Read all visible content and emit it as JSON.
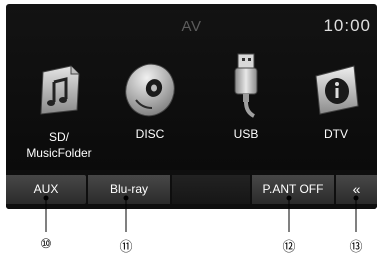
{
  "header": {
    "title": "AV",
    "clock": "10:00"
  },
  "sources": [
    {
      "label": "SD/\nMusicFolder",
      "icon": "music-note-icon"
    },
    {
      "label": "DISC",
      "icon": "disc-icon"
    },
    {
      "label": "USB",
      "icon": "usb-icon"
    },
    {
      "label": "DTV",
      "icon": "info-icon"
    }
  ],
  "bottom_bar": {
    "aux": "AUX",
    "bluray": "Blu-ray",
    "pant_off": "P.ANT OFF",
    "back": "«"
  },
  "callouts": [
    "⑩",
    "⑪",
    "⑫",
    "⑬"
  ],
  "colors": {
    "background": "#0e0e0e",
    "button": "#3a3a3a",
    "icon": "#c8c8c8",
    "callout_line": "#000000"
  }
}
